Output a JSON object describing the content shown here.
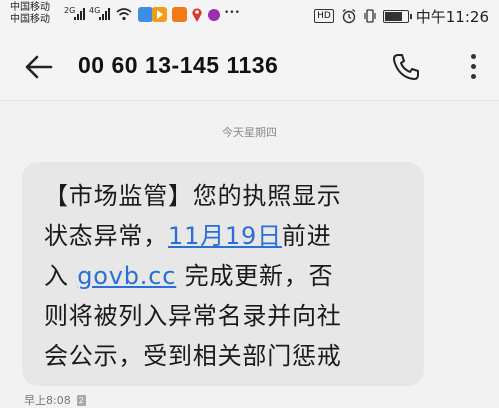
{
  "status_bar": {
    "carrier1": "中国移动",
    "carrier2": "中国移动",
    "net1": "2G",
    "net2": "4G",
    "hd": "HD",
    "time": "中午11:26",
    "battery_level": 0.8
  },
  "header": {
    "phone_number": "00 60 13-145 1136",
    "icons": [
      "back-arrow-icon",
      "phone-call-icon",
      "more-vertical-icon"
    ]
  },
  "conversation": {
    "date_separator": "今天星期四",
    "message": {
      "line1": "【市场监管】您的执照显示",
      "line2_pre": "状态异常，",
      "date_link": "11月19日",
      "line2_post": "前进",
      "line3_pre": "入 ",
      "url_link": "govb.cc",
      "line3_post": " 完成更新，否",
      "line4": "则将被列入异常名录并向社",
      "line5": "会公示，受到相关部门惩戒"
    },
    "timestamp": "早上8:08",
    "sim_label": "2"
  },
  "colors": {
    "background": "#f2f2f2",
    "bubble": "#e7e7e7",
    "link": "#2a6fd6"
  }
}
